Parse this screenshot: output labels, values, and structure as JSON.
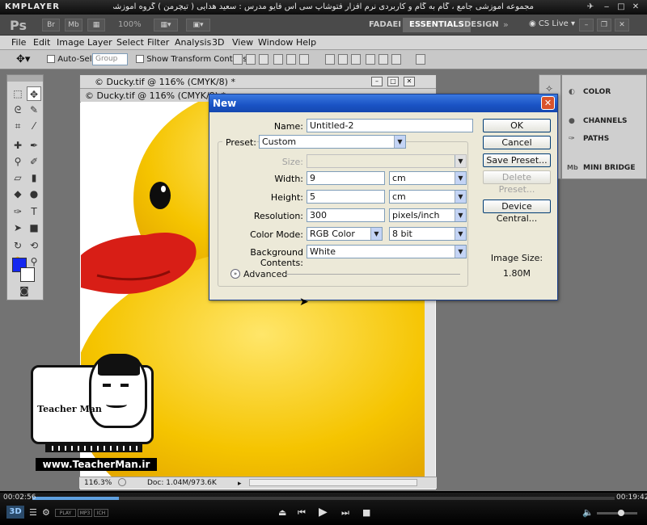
{
  "player": {
    "name": "KMPLAYER",
    "title": "مجموعه آموزشی جامع ، گام به گام و کاربردی نرم افزار فتوشاپ سی اس فایو مدرس : سعید هدایی ( تیچرمن ) گروه آموزشی پادشاه گرافیست ها",
    "time_elapsed": "00:02:56",
    "time_total": "00:19:42",
    "mode_badges": [
      "3D",
      "PLAY",
      "MP3",
      "ICH"
    ]
  },
  "photoshop": {
    "logo": "Ps",
    "zoom": "100%",
    "workspaces": [
      "FADAEI",
      "ESSENTIALS",
      "DESIGN"
    ],
    "active_workspace": "ESSENTIALS",
    "cs_live": "CS Live",
    "menu": [
      "File",
      "Edit",
      "Image",
      "Layer",
      "Select",
      "Filter",
      "Analysis",
      "3D",
      "View",
      "Window",
      "Help"
    ],
    "options": {
      "auto_select": "Auto-Select:",
      "auto_select_value": "Group",
      "show_transform": "Show Transform Controls"
    },
    "panels": [
      "COLOR",
      "CHANNELS",
      "PATHS",
      "MINI BRIDGE"
    ],
    "document": {
      "title_back": "© Ducky.tif @ 116% (CMYK/8) *",
      "title_front": "© Ducky.tif @ 116% (CMYK/8) *",
      "zoom": "116.3%",
      "doc_info": "Doc: 1.04M/973.6K"
    },
    "foreground_color": "#1428f0",
    "background_color": "#ffffff"
  },
  "dialog": {
    "title": "New",
    "name_label": "Name:",
    "name_value": "Untitled-2",
    "preset_label": "Preset:",
    "preset_value": "Custom",
    "size_label": "Size:",
    "size_value": "",
    "width_label": "Width:",
    "width_value": "9",
    "width_unit": "cm",
    "height_label": "Height:",
    "height_value": "5",
    "height_unit": "cm",
    "resolution_label": "Resolution:",
    "resolution_value": "300",
    "resolution_unit": "pixels/inch",
    "color_mode_label": "Color Mode:",
    "color_mode_value": "RGB Color",
    "bit_depth": "8 bit",
    "bg_contents_label": "Background Contents:",
    "bg_contents_value": "White",
    "advanced": "Advanced",
    "buttons": {
      "ok": "OK",
      "cancel": "Cancel",
      "save_preset": "Save Preset...",
      "delete_preset": "Delete Preset...",
      "device_central": "Device Central..."
    },
    "image_size_label": "Image Size:",
    "image_size_value": "1.80M"
  },
  "watermark": {
    "brand": "Teacher Man",
    "url": "www.TeacherMan.ir"
  },
  "playback": {
    "progress": 0.149
  }
}
